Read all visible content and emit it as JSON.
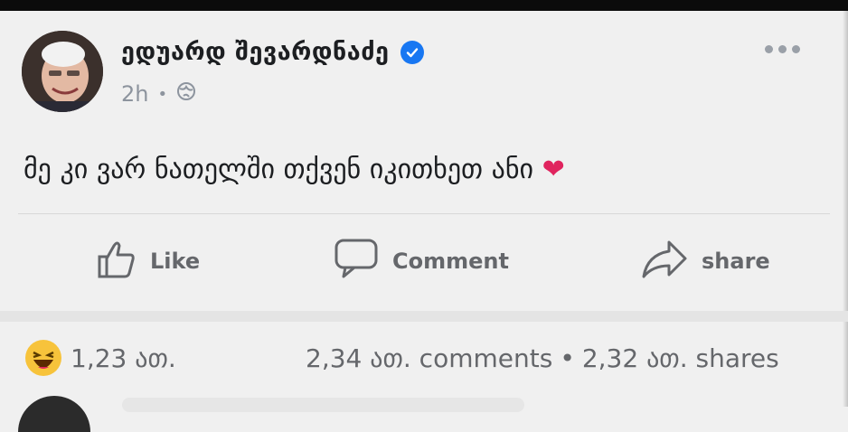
{
  "post": {
    "author": "ედუარდ შევარდნაძე",
    "time": "2h",
    "separator": "•",
    "text": "მე კი ვარ ნათელში თქვენ იკითხეთ ანი",
    "heart": "❤"
  },
  "actions": {
    "like": "Like",
    "comment": "Comment",
    "share": "share"
  },
  "stats": {
    "reactions": "1,23 ათ.",
    "comments": "2,34 ათ. comments",
    "separator": "•",
    "shares": "2,32 ათ. shares"
  },
  "colors": {
    "verified": "#1877f2",
    "heart": "#e0245e",
    "haha": "#f7c33b",
    "action_text": "#65676b"
  },
  "icons": [
    "globe-icon",
    "verified-icon",
    "more-icon",
    "like-icon",
    "comment-icon",
    "share-icon",
    "haha-reaction-icon"
  ]
}
